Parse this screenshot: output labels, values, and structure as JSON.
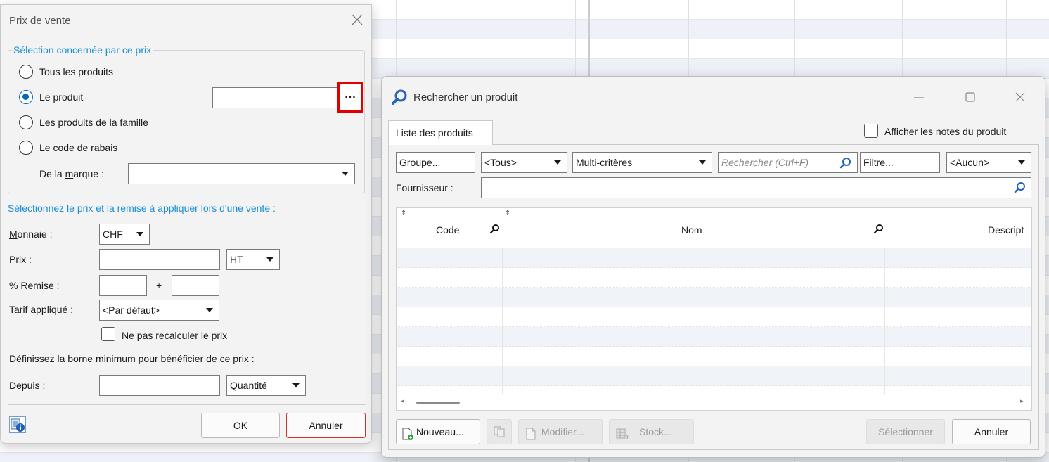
{
  "prix_dialog": {
    "title": "Prix de vente",
    "selection_group_title": "Sélection concernée par ce prix",
    "radio_options": [
      {
        "label": "Tous les produits",
        "checked": false
      },
      {
        "label": "Le produit",
        "checked": true
      },
      {
        "label": "Les produits de la famille",
        "checked": false
      },
      {
        "label": "Le code de rabais",
        "checked": false
      }
    ],
    "browse_button_label": "...",
    "brand_label_prefix": "De la ",
    "brand_label_accel": "m",
    "brand_label_suffix": "arque :",
    "brand_value": "",
    "price_section_title": "Sélectionnez le prix et la remise à appliquer lors d'une vente :",
    "currency_label_accel": "M",
    "currency_label_rest": "onnaie :",
    "currency_value": "CHF",
    "price_label": "Prix :",
    "price_value": "",
    "price_type_value": "HT",
    "discount_label": "% Remise :",
    "discount_plus": "+",
    "tariff_label": "Tarif appliqué :",
    "tariff_value": "<Par défaut>",
    "no_recalc_label": "Ne pas recalculer le prix",
    "min_threshold_text": "Définissez la borne minimum pour bénéficier de ce prix :",
    "since_label": "Depuis :",
    "since_value": "",
    "since_unit": "Quantité",
    "ok_label": "OK",
    "cancel_label": "Annuler",
    "highlight_color": "#e00000",
    "accent_color": "#1a8fd6"
  },
  "search_dialog": {
    "title": "Rechercher un produit",
    "tab_label": "Liste des produits",
    "show_notes_label": "Afficher les notes du produit",
    "group_button": "Groupe...",
    "group_select": "<Tous>",
    "criteria_select": "Multi-critères",
    "search_placeholder": "Rechercher (Ctrl+F)",
    "filter_button": "Filtre...",
    "filter_select": "<Aucun>",
    "supplier_label": "Fournisseur :",
    "supplier_value": "",
    "columns": [
      "Code",
      "Nom",
      "Descript"
    ],
    "new_button": "Nouveau...",
    "modify_button": "Modifier...",
    "stock_button": "Stock...",
    "select_button": "Sélectionner",
    "cancel_button": "Annuler"
  }
}
